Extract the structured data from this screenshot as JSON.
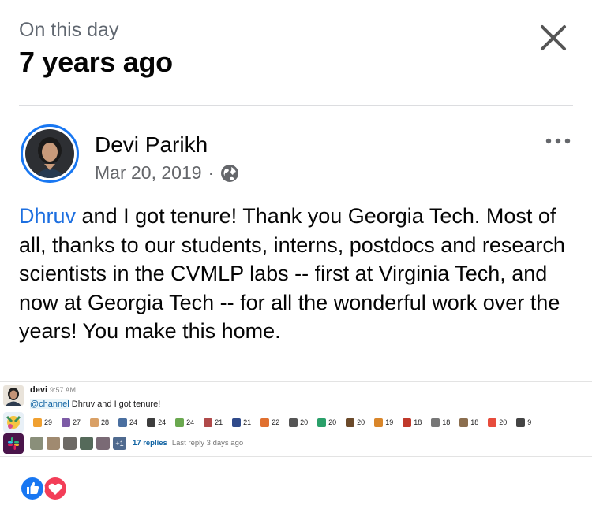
{
  "header": {
    "subtitle": "On this day",
    "title": "7 years ago"
  },
  "post": {
    "author": "Devi Parikh",
    "date": "Mar 20, 2019",
    "separator": "·",
    "audience_icon": "globe-icon",
    "text_mention": "Dhruv",
    "text_body": " and I got tenure! Thank you Georgia Tech. Most of all, thanks to our students, interns, postdocs and research scientists in the CVMLP labs -- first at Virginia Tech, and now at Georgia Tech -- for all the wonderful work over the years! You make this home."
  },
  "slack": {
    "sender": "devi",
    "time": "9:57 AM",
    "channel_tag": "@channel",
    "message": " Dhruv and I got tenure!",
    "reaction_counts": [
      "29",
      "27",
      "28",
      "24",
      "24",
      "24",
      "21",
      "21",
      "22",
      "20",
      "20",
      "20",
      "19",
      "18",
      "18",
      "18",
      "20",
      "9"
    ],
    "more_participants": "+1",
    "replies": "17 replies",
    "last_reply": "Last reply 3 days ago"
  },
  "colors": {
    "link": "#1d6fe0",
    "like": "#1877f2",
    "love": "#f33e58"
  }
}
